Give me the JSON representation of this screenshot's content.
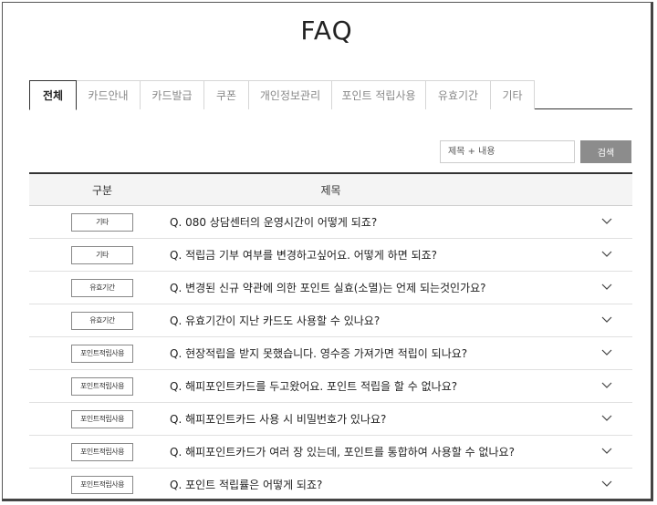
{
  "page": {
    "title": "FAQ"
  },
  "tabs": [
    {
      "label": "전체",
      "active": true
    },
    {
      "label": "카드안내",
      "active": false
    },
    {
      "label": "카드발급",
      "active": false
    },
    {
      "label": "쿠폰",
      "active": false
    },
    {
      "label": "개인정보관리",
      "active": false
    },
    {
      "label": "포인트 적립사용",
      "active": false
    },
    {
      "label": "유효기간",
      "active": false
    },
    {
      "label": "기타",
      "active": false
    }
  ],
  "search": {
    "placeholder": "제목 + 내용",
    "button_label": "검색"
  },
  "table": {
    "headers": {
      "category": "구분",
      "title": "제목"
    },
    "rows": [
      {
        "category": "기타",
        "question": "Q. 080 상담센터의 운영시간이 어떻게 되죠?"
      },
      {
        "category": "기타",
        "question": "Q. 적립금 기부 여부를 변경하고싶어요. 어떻게 하면 되죠?"
      },
      {
        "category": "유효기간",
        "question": "Q. 변경된 신규 약관에 의한 포인트 실효(소멸)는 언제 되는것인가요?"
      },
      {
        "category": "유효기간",
        "question": "Q. 유효기간이 지난 카드도 사용할 수 있나요?"
      },
      {
        "category": "포인트적립사용",
        "question": "Q. 현장적립을 받지 못했습니다. 영수증 가져가면 적립이 되나요?"
      },
      {
        "category": "포인트적립사용",
        "question": "Q. 해피포인트카드를 두고왔어요. 포인트 적립을 할 수 없나요?"
      },
      {
        "category": "포인트적립사용",
        "question": "Q. 해피포인트카드 사용 시 비밀번호가 있나요?"
      },
      {
        "category": "포인트적립사용",
        "question": "Q. 해피포인트카드가 여러 장 있는데, 포인트를 통합하여 사용할 수 없나요?"
      },
      {
        "category": "포인트적립사용",
        "question": "Q. 포인트 적립률은 어떻게 되죠?"
      }
    ]
  }
}
